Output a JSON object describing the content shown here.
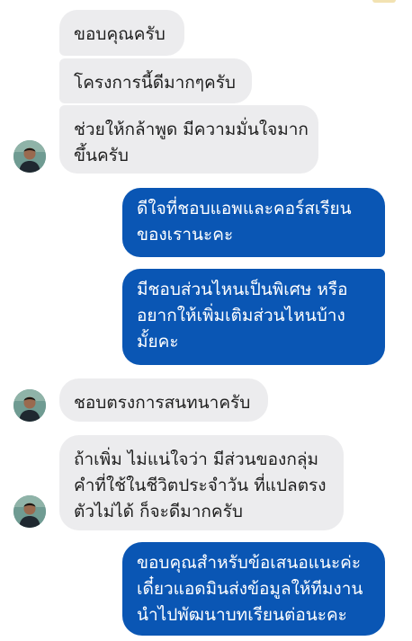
{
  "conversation": {
    "messages": [
      {
        "from": "user",
        "text": "ขอบคุณครับ"
      },
      {
        "from": "user",
        "text": "โครงการนี้ดีมากๆครับ"
      },
      {
        "from": "user",
        "text": "ช่วยให้กล้าพูด มีความมั่นใจมาก\nขึ้นครับ"
      },
      {
        "from": "admin",
        "text": "ดีใจที่ชอบแอพและคอร์สเรียน\nของเรานะคะ"
      },
      {
        "from": "admin",
        "text": "มีชอบส่วนไหนเป็นพิเศษ หรือ\nอยากให้เพิ่มเติมส่วนไหนบ้าง\nมั้ยคะ"
      },
      {
        "from": "user",
        "text": "ชอบตรงการสนทนาครับ"
      },
      {
        "from": "user",
        "text": "ถ้าเพิ่ม ไม่แน่ใจว่า มีส่วนของกลุ่ม\nคำที่ใช้ในชีวิตประจำวัน ที่แปลตรง\nตัวไม่ได้ ก็จะดีมากครับ"
      },
      {
        "from": "admin",
        "text": "ขอบคุณสำหรับข้อเสนอแนะค่ะ\nเดี๋ยวแอดมินส่งข้อมูลให้ทีมงาน\nนำไปพัฒนาบทเรียนต่อนะคะ"
      }
    ]
  },
  "colors": {
    "incoming_bubble": "#ececee",
    "outgoing_bubble": "#0a56b4",
    "incoming_text": "#1f1f1f",
    "outgoing_text": "#ffffff"
  },
  "icons": {
    "avatar": "user-avatar"
  }
}
